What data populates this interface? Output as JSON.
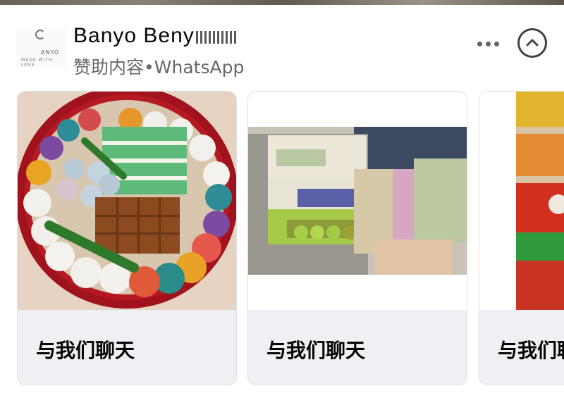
{
  "post": {
    "page_name": "Banyo Beny",
    "sponsored_label": "赞助内容",
    "separator": "•",
    "platform": "WhatsApp",
    "avatar_text_main": "ANYO",
    "avatar_text_sub": "MADE WITH LOVE"
  },
  "actions": {
    "more_icon": "more-horizontal-icon",
    "collapse_icon": "chevron-up-circle-icon"
  },
  "carousel": {
    "cards": [
      {
        "image": "kuih tray in red round container",
        "cta_label": "与我们聊天"
      },
      {
        "image": "kuih display trays at market stall",
        "cta_label": "与我们聊天"
      },
      {
        "image": "layered kuih close-up",
        "cta_label": "与我们聊天"
      }
    ]
  },
  "colors": {
    "text_primary": "#050505",
    "text_secondary": "#65676b",
    "cta_background": "#eef0f3",
    "card_border": "#dfe1e5"
  }
}
